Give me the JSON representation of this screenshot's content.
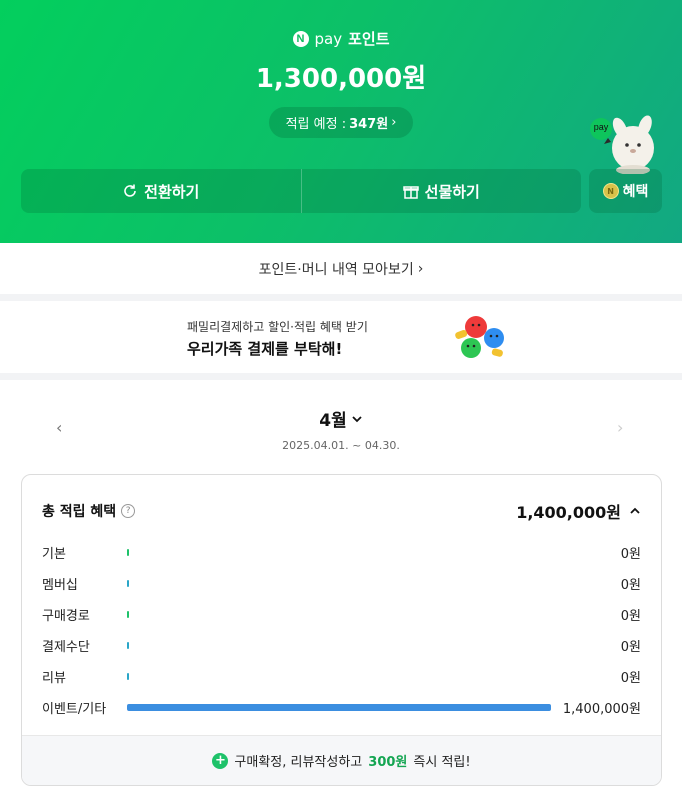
{
  "header": {
    "brand_logo": "N",
    "brand_pay": "pay",
    "brand_title": "포인트",
    "amount": "1,300,000원",
    "expected_label": "적립 예정 :",
    "expected_value": "347원",
    "expected_chevron": "›",
    "mascot_badge": "pay",
    "convert_label": "전환하기",
    "gift_label": "선물하기",
    "benefit_label": "혜택",
    "colors": {
      "gradient_start": "#03cf5d",
      "gradient_end": "#12a882"
    }
  },
  "history_link": {
    "label": "포인트·머니 내역 모아보기",
    "chevron": "›"
  },
  "banner": {
    "subtitle": "패밀리결제하고 할인·적립 혜택 받기",
    "title": "우리가족 결제를 부탁해!"
  },
  "period": {
    "month": "4월",
    "range": "2025.04.01. ~ 04.30.",
    "prev_arrow": "‹",
    "next_arrow": "›"
  },
  "summary": {
    "title": "총 적립 혜택",
    "help": "?",
    "total": "1,400,000원",
    "rows": [
      {
        "label": "기본",
        "value": "0원",
        "ratio": 0.0,
        "color": "#1ec26a"
      },
      {
        "label": "멤버십",
        "value": "0원",
        "ratio": 0.0,
        "color": "#2aa6c8"
      },
      {
        "label": "구매경로",
        "value": "0원",
        "ratio": 0.0,
        "color": "#1ec26a"
      },
      {
        "label": "결제수단",
        "value": "0원",
        "ratio": 0.0,
        "color": "#2aa6c8"
      },
      {
        "label": "리뷰",
        "value": "0원",
        "ratio": 0.0,
        "color": "#2aa6c8"
      },
      {
        "label": "이벤트/기타",
        "value": "1,400,000원",
        "ratio": 1.0,
        "color": "#3b8ee0"
      }
    ],
    "footer_pre": "구매확정, 리뷰작성하고",
    "footer_highlight": "300원",
    "footer_post": "즉시 적립!"
  }
}
